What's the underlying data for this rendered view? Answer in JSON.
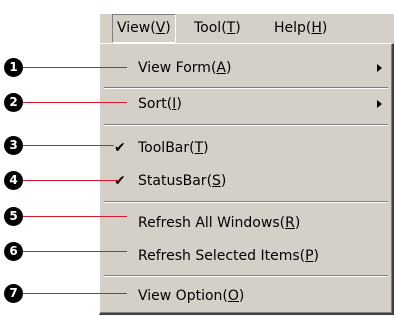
{
  "menubar": {
    "items": [
      {
        "label": "View",
        "hotkey": "V"
      },
      {
        "label": "Tool",
        "hotkey": "T"
      },
      {
        "label": "Help",
        "hotkey": "H"
      }
    ]
  },
  "menu": {
    "items": [
      {
        "label": "View Form",
        "hotkey": "A",
        "submenu": true
      },
      {
        "label": "Sort",
        "hotkey": "I",
        "submenu": true
      },
      {
        "label": "ToolBar",
        "hotkey": "T",
        "checked": true
      },
      {
        "label": "StatusBar",
        "hotkey": "S",
        "checked": true
      },
      {
        "label": "Refresh All Windows",
        "hotkey": "R"
      },
      {
        "label": "Refresh Selected Items",
        "hotkey": "P"
      },
      {
        "label": "View Option",
        "hotkey": "O"
      }
    ],
    "check_glyph": "✔"
  },
  "callouts": [
    "1",
    "2",
    "3",
    "4",
    "5",
    "6",
    "7"
  ],
  "colors": {
    "menu_bg": "#d4d0c8",
    "leader_line": "#d8182d",
    "callout_bg": "#000000"
  }
}
